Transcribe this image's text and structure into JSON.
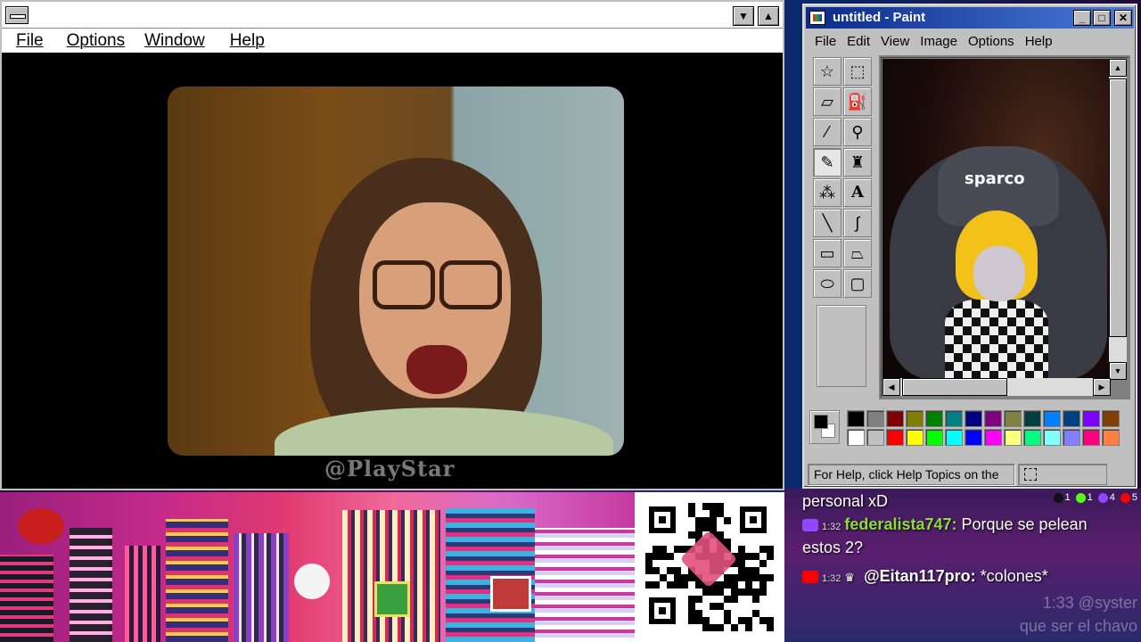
{
  "media_window": {
    "menu": [
      "File",
      "Options",
      "Window",
      "Help"
    ],
    "title_buttons": [
      "▼",
      "▲"
    ],
    "watermark": "@PlayStar"
  },
  "paint": {
    "title": "untitled - Paint",
    "title_buttons": [
      "_",
      "□",
      "✕"
    ],
    "menu": [
      "File",
      "Edit",
      "View",
      "Image",
      "Options",
      "Help"
    ],
    "tools": [
      "free-select",
      "select",
      "eraser",
      "fill",
      "picker",
      "magnifier",
      "pencil",
      "brush",
      "airbrush",
      "text",
      "line",
      "curve",
      "rectangle",
      "polygon",
      "ellipse",
      "rounded-rect"
    ],
    "canvas_brand": "sparco",
    "status_text": "For Help, click Help Topics on the",
    "palette_top": [
      "#000000",
      "#808080",
      "#800000",
      "#808000",
      "#008000",
      "#008080",
      "#000080",
      "#800080",
      "#808040",
      "#004040",
      "#0080ff",
      "#004080",
      "#8000ff",
      "#804000"
    ],
    "palette_bottom": [
      "#ffffff",
      "#c0c0c0",
      "#ff0000",
      "#ffff00",
      "#00ff00",
      "#00ffff",
      "#0000ff",
      "#ff00ff",
      "#ffff80",
      "#00ff80",
      "#80ffff",
      "#8080ff",
      "#ff0080",
      "#ff8040"
    ],
    "current_fg": "#000000",
    "current_bg": "#ffffff"
  },
  "chat": {
    "top_counts": [
      "1",
      "1",
      "4",
      "5"
    ],
    "line0": "personal xD",
    "msg1": {
      "time": "1:32",
      "user": "federalista747:",
      "text": " Porque se pelean"
    },
    "line2": "estos 2?",
    "msg3": {
      "time": "1:32",
      "user": "@Eitan117pro:",
      "text": " *colones*"
    },
    "faded1": "1:33 @syster",
    "faded2": "que ser el chavo"
  }
}
